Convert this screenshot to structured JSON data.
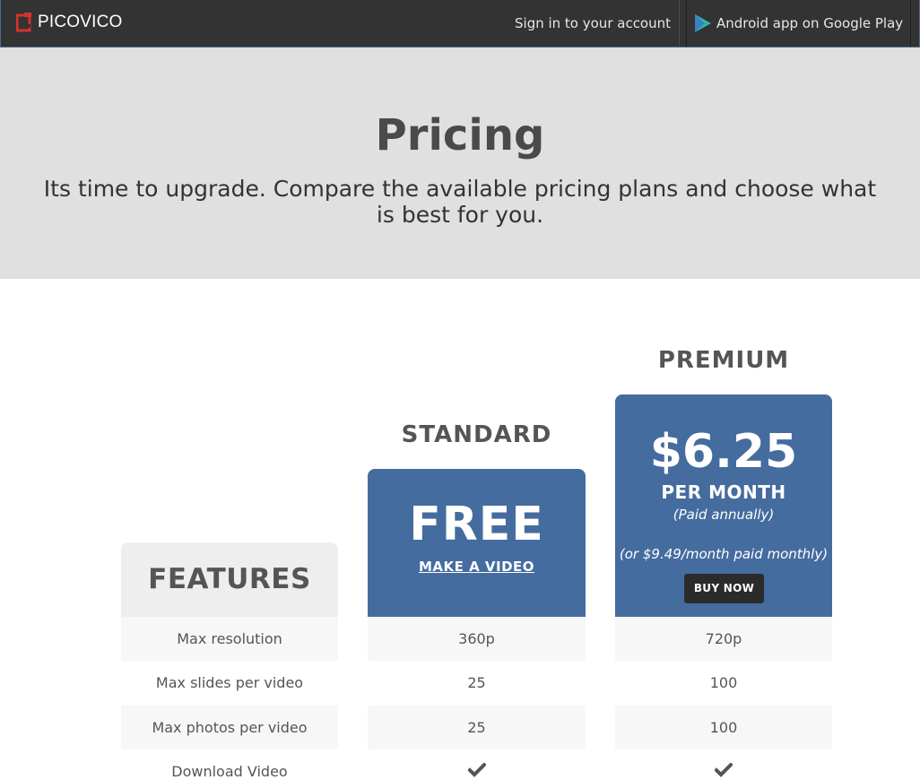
{
  "topbar": {
    "brand": "PICOVICO",
    "signin": "Sign in to your account",
    "android": "Android app on Google Play",
    "colors": {
      "bar": "#333333",
      "logo": "#d6322c",
      "play_a": "#2fb6a6",
      "play_b": "#3b7fc4"
    }
  },
  "hero": {
    "title": "Pricing",
    "subtitle": "Its time to upgrade. Compare the available pricing plans and choose what is best for you."
  },
  "pricing": {
    "features_heading": "FEATURES",
    "standard": {
      "name": "STANDARD",
      "price": "FREE",
      "cta": "MAKE A VIDEO"
    },
    "premium": {
      "name": "PREMIUM",
      "price": "$6.25",
      "period": "PER MONTH",
      "billing_note": "(Paid annually)",
      "monthly_note": "(or $9.49/month paid monthly)",
      "cta": "BUY NOW"
    },
    "accent_color": "#456c9f",
    "rows": [
      {
        "feature": "Max resolution",
        "standard": "360p",
        "premium": "720p"
      },
      {
        "feature": "Max slides per video",
        "standard": "25",
        "premium": "100"
      },
      {
        "feature": "Max photos per video",
        "standard": "25",
        "premium": "100"
      },
      {
        "feature": "Download Video",
        "standard": "check-icon",
        "premium": "check-icon"
      }
    ]
  }
}
